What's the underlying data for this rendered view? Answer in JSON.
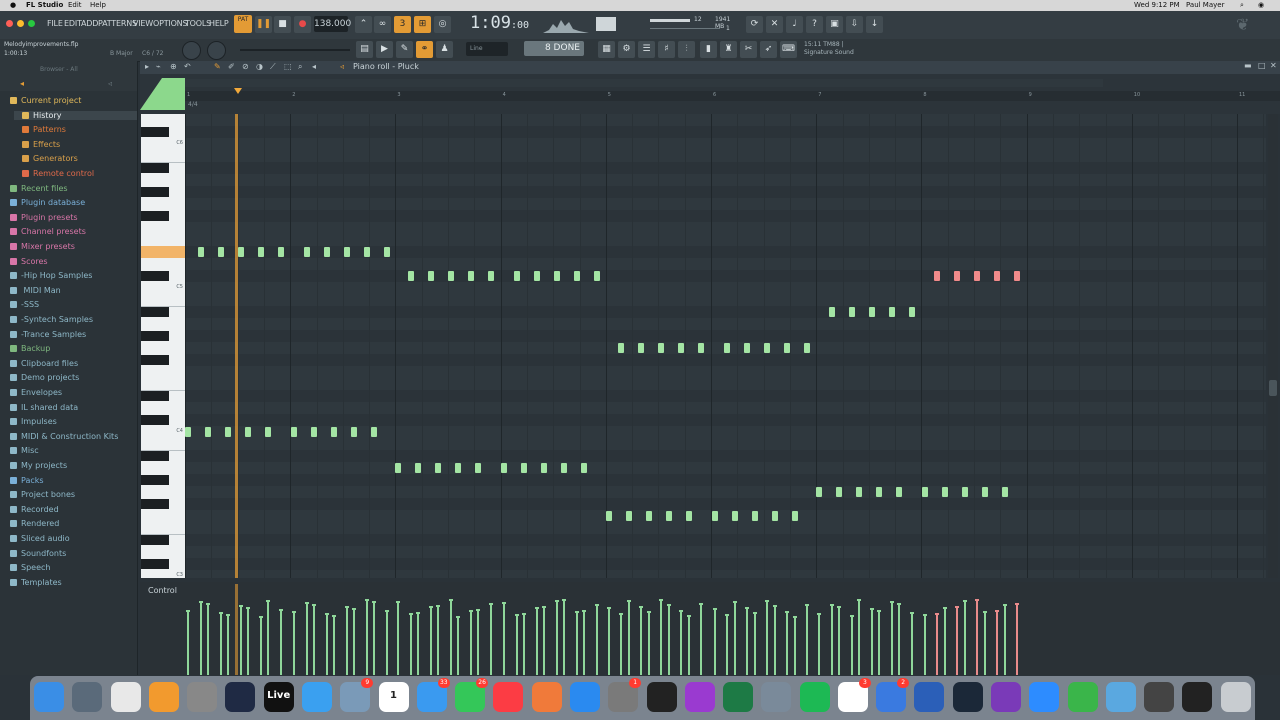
{
  "mac_menubar": {
    "app_name": "FL Studio",
    "menus": [
      "Edit",
      "Help"
    ],
    "clock": "Wed 9:12 PM",
    "user": "Paul Mayer"
  },
  "fl_menu": [
    "FILE",
    "EDIT",
    "ADD",
    "PATTERNS",
    "VIEW",
    "OPTIONS",
    "TOOLS",
    "HELP"
  ],
  "transport": {
    "mode": "PAT",
    "tempo": "138.000",
    "time_display": "1:09",
    "time_sub": ":00",
    "cpu_top": "12",
    "memory": "1941 MB",
    "cpu_bottom": "1"
  },
  "project": {
    "file_name": "Melodyimprovements.flp",
    "position": "1:00:13",
    "scale": "B Major",
    "voices": "C6 / 72"
  },
  "toolbar2": {
    "snap": "Line",
    "done_label": "8 DONE",
    "hint_line1": "15:11  TM88 |",
    "hint_line2": "Signature Sound"
  },
  "piano_roll": {
    "title": "Piano roll - Pluck",
    "time_sig": "4/4",
    "bar_numbers": [
      "1",
      "2",
      "3",
      "4",
      "5",
      "6",
      "7",
      "8",
      "9",
      "10",
      "11"
    ],
    "key_labels": [
      "C6",
      "C5",
      "C4",
      "C3"
    ],
    "control_label": "Control"
  },
  "browser": {
    "title": "Browser - All",
    "items": [
      {
        "label": "Current project",
        "indent": 0,
        "color": "#e0b85a"
      },
      {
        "label": "History",
        "indent": 1,
        "color": "#e0b85a",
        "selected": true
      },
      {
        "label": "Patterns",
        "indent": 1,
        "color": "#e07a3a"
      },
      {
        "label": "Effects",
        "indent": 1,
        "color": "#d9a04a"
      },
      {
        "label": "Generators",
        "indent": 1,
        "color": "#d9a04a"
      },
      {
        "label": "Remote control",
        "indent": 1,
        "color": "#e06a4a"
      },
      {
        "label": "Recent files",
        "indent": 0,
        "color": "#7fb87f"
      },
      {
        "label": "Plugin database",
        "indent": 0,
        "color": "#7ab0d8"
      },
      {
        "label": "Plugin presets",
        "indent": 0,
        "color": "#d876a8"
      },
      {
        "label": "Channel presets",
        "indent": 0,
        "color": "#d876a8"
      },
      {
        "label": "Mixer presets",
        "indent": 0,
        "color": "#d876a8"
      },
      {
        "label": "Scores",
        "indent": 0,
        "color": "#d876a8"
      },
      {
        "label": "-Hip Hop Samples",
        "indent": 0,
        "color": "#8eb8c8"
      },
      {
        "label": " MIDI Man",
        "indent": 0,
        "color": "#8eb8c8"
      },
      {
        "label": "-SSS",
        "indent": 0,
        "color": "#8eb8c8"
      },
      {
        "label": "-Syntech Samples",
        "indent": 0,
        "color": "#8eb8c8"
      },
      {
        "label": "-Trance Samples",
        "indent": 0,
        "color": "#8eb8c8"
      },
      {
        "label": "Backup",
        "indent": 0,
        "color": "#7fb87f"
      },
      {
        "label": "Clipboard files",
        "indent": 0,
        "color": "#8eb8c8"
      },
      {
        "label": "Demo projects",
        "indent": 0,
        "color": "#8eb8c8"
      },
      {
        "label": "Envelopes",
        "indent": 0,
        "color": "#8eb8c8"
      },
      {
        "label": "IL shared data",
        "indent": 0,
        "color": "#8eb8c8"
      },
      {
        "label": "Impulses",
        "indent": 0,
        "color": "#8eb8c8"
      },
      {
        "label": "MIDI & Construction Kits",
        "indent": 0,
        "color": "#8eb8c8"
      },
      {
        "label": "Misc",
        "indent": 0,
        "color": "#8eb8c8"
      },
      {
        "label": "My projects",
        "indent": 0,
        "color": "#8eb8c8"
      },
      {
        "label": "Packs",
        "indent": 0,
        "color": "#7ab0d8"
      },
      {
        "label": "Project bones",
        "indent": 0,
        "color": "#8eb8c8"
      },
      {
        "label": "Recorded",
        "indent": 0,
        "color": "#8eb8c8"
      },
      {
        "label": "Rendered",
        "indent": 0,
        "color": "#8eb8c8"
      },
      {
        "label": "Sliced audio",
        "indent": 0,
        "color": "#8eb8c8"
      },
      {
        "label": "Soundfonts",
        "indent": 0,
        "color": "#8eb8c8"
      },
      {
        "label": "Speech",
        "indent": 0,
        "color": "#8eb8c8"
      },
      {
        "label": "Templates",
        "indent": 0,
        "color": "#8eb8c8"
      }
    ]
  },
  "dock_apps": [
    {
      "name": "finder",
      "color": "#3a8ee6"
    },
    {
      "name": "launchpad",
      "color": "#5a6a7a"
    },
    {
      "name": "chrome",
      "color": "#e8e8e8"
    },
    {
      "name": "fl-studio",
      "color": "#f29a2e"
    },
    {
      "name": "app-settings",
      "color": "#888888"
    },
    {
      "name": "ableton",
      "color": "#1f2a44"
    },
    {
      "name": "live",
      "color": "#111111",
      "label": "Live"
    },
    {
      "name": "safari",
      "color": "#3aa0f0"
    },
    {
      "name": "preview",
      "color": "#7a9ab8",
      "badge": "9"
    },
    {
      "name": "calendar",
      "color": "#ffffff",
      "label": "1"
    },
    {
      "name": "messages-blue",
      "color": "#3a9af0",
      "badge": "33"
    },
    {
      "name": "messages",
      "color": "#34c759",
      "badge": "26"
    },
    {
      "name": "music",
      "color": "#fc3c44"
    },
    {
      "name": "swift",
      "color": "#f07a3a"
    },
    {
      "name": "app-store",
      "color": "#2a8af0"
    },
    {
      "name": "system-preferences",
      "color": "#7a7a7a",
      "badge": "1"
    },
    {
      "name": "terminal",
      "color": "#222222"
    },
    {
      "name": "affinity",
      "color": "#9a3ad0"
    },
    {
      "name": "excel",
      "color": "#1d7a45"
    },
    {
      "name": "image-viewer",
      "color": "#7a8a9a"
    },
    {
      "name": "spotify",
      "color": "#1db954"
    },
    {
      "name": "slack",
      "color": "#ffffff",
      "badge": "3"
    },
    {
      "name": "vpn",
      "color": "#3a7ae0",
      "badge": "2"
    },
    {
      "name": "word",
      "color": "#2b5fb8"
    },
    {
      "name": "steam",
      "color": "#1b2838"
    },
    {
      "name": "onenote",
      "color": "#7a3ab8"
    },
    {
      "name": "zoom",
      "color": "#2d8cff"
    },
    {
      "name": "camtasia",
      "color": "#3ab54a"
    },
    {
      "name": "folder",
      "color": "#5aa8e0"
    },
    {
      "name": "screenshot",
      "color": "#444444"
    },
    {
      "name": "monitor",
      "color": "#222222"
    },
    {
      "name": "trash",
      "color": "#c8ccd0"
    }
  ],
  "colors": {
    "note_green": "#a4e5a4",
    "note_red": "#f08a8a",
    "playhead": "#e39b35",
    "accent_orange": "#e39b35"
  },
  "notes": {
    "comment_units": "bars from song start; rows are pitch rows",
    "groups": [
      {
        "row": "D#5",
        "start": 0.12,
        "count": 10,
        "color": "green"
      },
      {
        "row": "C#5",
        "start": 2.12,
        "count": 10,
        "color": "green"
      },
      {
        "row": "G4",
        "start": 4.12,
        "count": 10,
        "color": "green"
      },
      {
        "row": "A#4",
        "start": 6.12,
        "count": 5,
        "color": "green"
      },
      {
        "row": "C#5",
        "start": 7.12,
        "count": 5,
        "color": "red"
      },
      {
        "row": "C4",
        "start": 0.0,
        "count": 10,
        "color": "green"
      },
      {
        "row": "A3",
        "start": 2.0,
        "count": 10,
        "color": "green"
      },
      {
        "row": "F3",
        "start": 4.0,
        "count": 10,
        "color": "green"
      },
      {
        "row": "G3",
        "start": 6.0,
        "count": 10,
        "color": "green"
      }
    ]
  }
}
